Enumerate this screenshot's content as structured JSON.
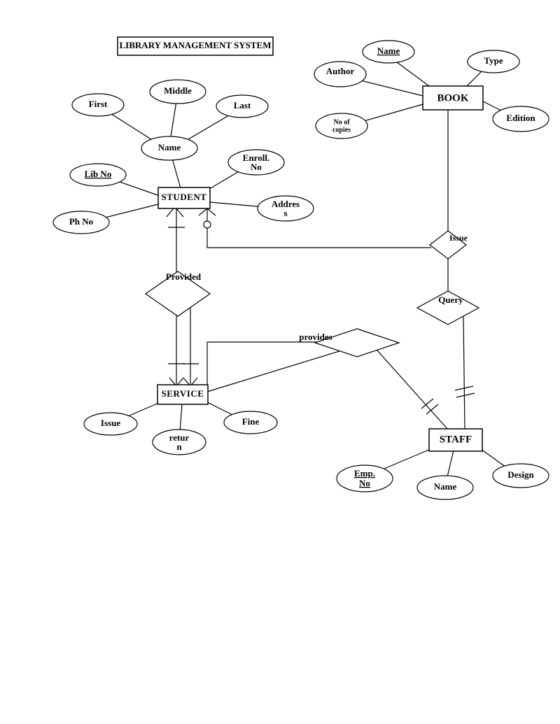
{
  "title": "LIBRARY MANAGEMENT SYSTEM",
  "entities": {
    "book": "BOOK",
    "student": "STUDENT",
    "service": "SERVICE",
    "staff": "STAFF"
  },
  "book_attrs": {
    "name": "Name",
    "author": "Author",
    "type": "Type",
    "edition": "Edition",
    "no_of_copies_l1": "No of",
    "no_of_copies_l2": "copies"
  },
  "student_attrs": {
    "first": "First",
    "middle": "Middle",
    "last": "Last",
    "name": "Name",
    "lib_no": "Lib No",
    "enroll_l1": "Enroll.",
    "enroll_l2": "No",
    "ph_no": "Ph No",
    "address_l1": "Addres",
    "address_l2": "s"
  },
  "service_attrs": {
    "issue": "Issue",
    "return_l1": "retur",
    "return_l2": "n",
    "fine": "Fine"
  },
  "staff_attrs": {
    "emp_no_l1": "Emp.",
    "emp_no_l2": "No",
    "name": "Name",
    "design": "Design"
  },
  "relationships": {
    "issue": "Issue",
    "provided": "Provided",
    "provides": "provides",
    "query": "Query"
  }
}
